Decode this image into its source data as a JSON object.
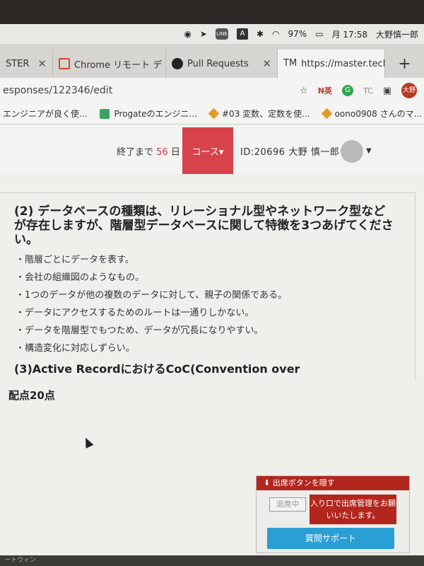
{
  "menubar": {
    "battery": "97%",
    "day": "月",
    "time": "17:58",
    "user": "大野慎一郎",
    "line_label": "LINE",
    "a_label": "A"
  },
  "tabs": [
    {
      "label": "STER"
    },
    {
      "label": "Chrome リモート デ"
    },
    {
      "label": "Pull Requests"
    },
    {
      "label": "https://master.tech"
    }
  ],
  "newtab": "+",
  "address": {
    "url": "esponses/122346/edit",
    "ext_n": "N英",
    "ext_g": "G",
    "ext_tc": "TC",
    "profile": "大野"
  },
  "bookmarks": [
    {
      "label": "エンジニアが良く使..."
    },
    {
      "label": "Progateのエンジニ..."
    },
    {
      "label": "#03 変数、定数を使..."
    },
    {
      "label": "oono0908 さんのマ..."
    }
  ],
  "header": {
    "countdown_prefix": "終了まで",
    "countdown_days": "56",
    "countdown_suffix": "日",
    "course_label": "コース▾",
    "user_id": "ID:20696 大野 慎一郎",
    "avatar_text": "avatar"
  },
  "question": {
    "title": "(2) データベースの種類は、リレーショナル型やネットワーク型などが存在しますが、階層型データベースに関して特徴を3つあげてください。",
    "answers": [
      "・階層ごとにデータを表す。",
      "・会社の組織図のようなもの。",
      "・1つのデータが他の複数のデータに対して、親子の関係である。",
      "・データにアクセスするためのルートは一通りしかない。",
      "・データを階層型でもつため、データが冗長になりやすい。",
      "・構造変化に対応しずらい。"
    ],
    "next_title": "(3)Active RecordにおけるCoC(Convention over"
  },
  "points": "配点20点",
  "attendance": {
    "hide_label": "⬇ 出席ボタンを隠す",
    "leave_label": "退席中",
    "note": "入り口で出席管理をお願いいたします。",
    "support_label": "質問サポート"
  },
  "bottom": "ートウィン"
}
